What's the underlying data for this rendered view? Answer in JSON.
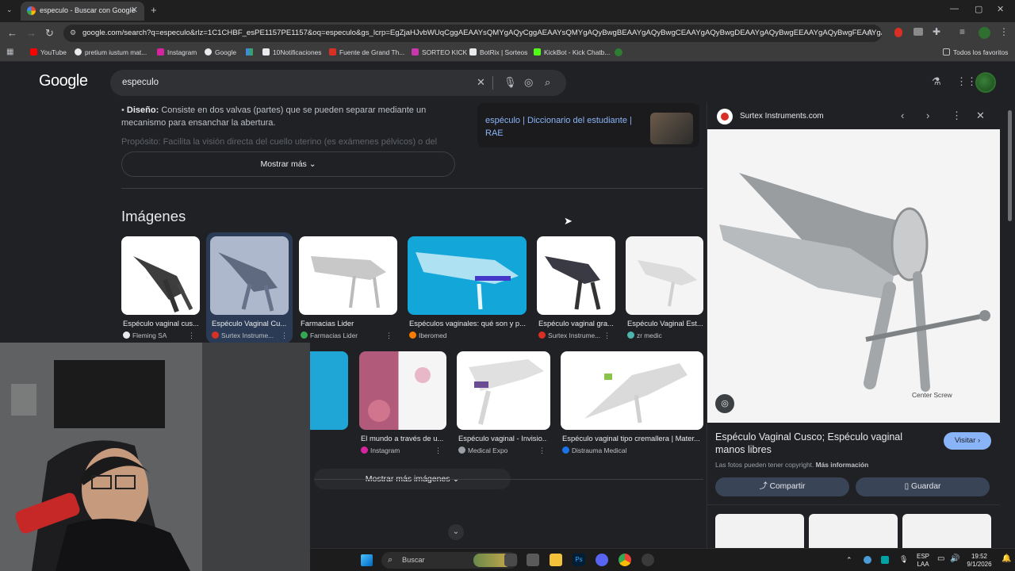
{
  "browser": {
    "tab_title": "especulo - Buscar con Google",
    "url": "google.com/search?q=especulo&rlz=1C1CHBF_esPE1157PE1157&oq=especulo&gs_lcrp=EgZjaHJvbWUqCggAEAAYsQMYgAQyCggAEAAYsQMYgAQyBwgBEAAYgAQyBwgCEAAYgAQyBwgDEAAYgAQyBwgEEAAYgAQyBwgFEAAYgAQyCQgG...",
    "bookmarks": [
      "YouTube",
      "pretium iustum mat...",
      "Instagram",
      "Google",
      "10Notificaciones",
      "Fuente de Grand Th...",
      "SORTEO KICK",
      "BotRix | Sorteos",
      "KickBot - Kick Chatb...",
      "Todos los favoritos"
    ]
  },
  "google": {
    "logo": "Google",
    "query": "especulo",
    "bullet_label": "Diseño:",
    "bullet_text": "Consiste en dos valvas (partes) que se pueden separar mediante un mecanismo para ensanchar la abertura.",
    "bullet_faded": "Propósito: Facilita la visión directa del cuello uterino (es exámenes pélvicos) o del",
    "mostrar_mas": "Mostrar más",
    "dict_title": "espéculo | Diccionario del estudiante | RAE",
    "images_title": "Imágenes",
    "row1": [
      {
        "caption": "Espéculo vaginal cus...",
        "source": "Fleming SA"
      },
      {
        "caption": "Espéculo Vaginal Cu...",
        "source": "Surtex Instrume..."
      },
      {
        "caption": "Farmacias Lider",
        "source": "Farmacias Lider"
      },
      {
        "caption": "Espéculos vaginales: qué son y p...",
        "source": "Iberomed"
      },
      {
        "caption": "Espéculo vaginal gra...",
        "source": "Surtex Instrume..."
      },
      {
        "caption": "Espéculo Vaginal Est...",
        "source": "zr medic"
      }
    ],
    "row2": [
      {
        "caption": "El mundo a través de u...",
        "source": "Instagram"
      },
      {
        "caption": "Espéculo vaginal - Invisio...",
        "source": "Medical Expo"
      },
      {
        "caption": "Espéculo vaginal tipo cremallera | Mater...",
        "source": "Distrauma Medical"
      }
    ],
    "mostrar_mas_imagenes": "Mostrar más imágenes"
  },
  "panel": {
    "site": "Surtex Instruments.com",
    "image_label": "Center Screw",
    "title": "Espéculo Vaginal Cusco; Espéculo vaginal manos libres",
    "visit": "Visitar",
    "copyright": "Las fotos pueden tener copyright.",
    "more_info": "Más información",
    "share": "Compartir",
    "save": "Guardar"
  },
  "taskbar": {
    "search": "Buscar",
    "lang1": "ESP",
    "lang2": "LAA",
    "time": "19:52",
    "date": "9/1/2026"
  }
}
